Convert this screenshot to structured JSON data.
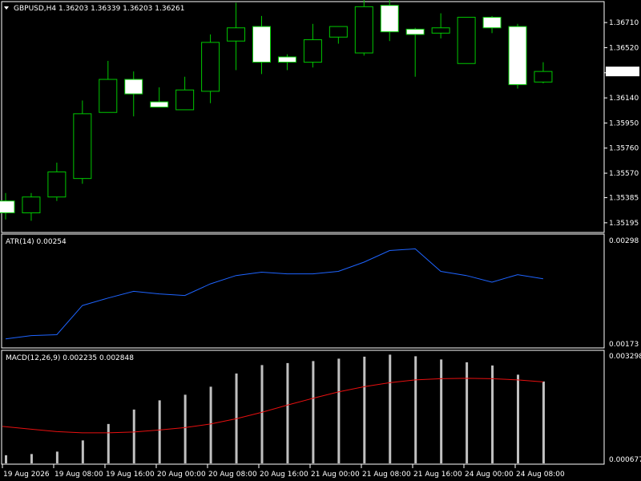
{
  "window": {
    "symbol_line": "GBPUSD,H4  1.36203 1.36339 1.36203 1.36261",
    "current_price_label": "1.36261"
  },
  "colors": {
    "background": "#000000",
    "panel_border": "#ffffff",
    "bull_candle": "#00c800",
    "bear_fill": "#ffffff",
    "atr_line": "#1e64ff",
    "macd_signal": "#e81010",
    "macd_hist": "#c0c0c0"
  },
  "chart_data": [
    {
      "type": "candlestick",
      "title": "GBPUSD,H4",
      "ohlc_text": "1.36203 1.36339 1.36203 1.36261",
      "y_ticks": [
        1.35195,
        1.35385,
        1.3557,
        1.3576,
        1.3595,
        1.3614,
        1.3633,
        1.3652,
        1.3671
      ],
      "y_tick_labels": [
        "1.35195",
        "1.35385",
        "1.35570",
        "1.35760",
        "1.35950",
        "1.36140",
        "1.36330",
        "1.36520",
        "1.36710"
      ],
      "ylim": [
        1.3517,
        1.3682
      ],
      "candles": [
        {
          "o": 1.3536,
          "h": 1.3542,
          "l": 1.3522,
          "c": 1.3527
        },
        {
          "o": 1.3527,
          "h": 1.3542,
          "l": 1.3521,
          "c": 1.3539
        },
        {
          "o": 1.3539,
          "h": 1.3565,
          "l": 1.3536,
          "c": 1.3558
        },
        {
          "o": 1.3553,
          "h": 1.3612,
          "l": 1.3549,
          "c": 1.3602
        },
        {
          "o": 1.3603,
          "h": 1.3642,
          "l": 1.3603,
          "c": 1.3628
        },
        {
          "o": 1.3628,
          "h": 1.3634,
          "l": 1.36,
          "c": 1.3617
        },
        {
          "o": 1.3611,
          "h": 1.3622,
          "l": 1.3608,
          "c": 1.3607
        },
        {
          "o": 1.3605,
          "h": 1.363,
          "l": 1.3605,
          "c": 1.362
        },
        {
          "o": 1.3619,
          "h": 1.3662,
          "l": 1.361,
          "c": 1.3656
        },
        {
          "o": 1.3657,
          "h": 1.3686,
          "l": 1.3635,
          "c": 1.3667
        },
        {
          "o": 1.3668,
          "h": 1.3676,
          "l": 1.3632,
          "c": 1.3641
        },
        {
          "o": 1.3645,
          "h": 1.3647,
          "l": 1.3635,
          "c": 1.3641
        },
        {
          "o": 1.3641,
          "h": 1.367,
          "l": 1.3637,
          "c": 1.3658
        },
        {
          "o": 1.366,
          "h": 1.3667,
          "l": 1.3655,
          "c": 1.3668
        },
        {
          "o": 1.3648,
          "h": 1.369,
          "l": 1.3646,
          "c": 1.3683
        },
        {
          "o": 1.3684,
          "h": 1.3704,
          "l": 1.3657,
          "c": 1.3664
        },
        {
          "o": 1.3666,
          "h": 1.3667,
          "l": 1.363,
          "c": 1.3662
        },
        {
          "o": 1.3663,
          "h": 1.3678,
          "l": 1.3659,
          "c": 1.3667
        },
        {
          "o": 1.364,
          "h": 1.3675,
          "l": 1.364,
          "c": 1.3675
        },
        {
          "o": 1.3675,
          "h": 1.3676,
          "l": 1.3663,
          "c": 1.3667
        },
        {
          "o": 1.3668,
          "h": 1.367,
          "l": 1.3621,
          "c": 1.3624
        },
        {
          "o": 1.3626,
          "h": 1.3641,
          "l": 1.3625,
          "c": 1.3634
        }
      ]
    },
    {
      "type": "line",
      "title": "ATR(14) 0.00254",
      "y_tick_labels": [
        "0.00298",
        "0.00173"
      ],
      "ylim": [
        0.00173,
        0.00298
      ],
      "series": [
        {
          "values": [
            0.0018,
            0.00184,
            0.00185,
            0.0022,
            0.00229,
            0.00237,
            0.00234,
            0.00232,
            0.00246,
            0.00256,
            0.0026,
            0.00258,
            0.00258,
            0.00261,
            0.00272,
            0.00286,
            0.00288,
            0.00261,
            0.00256,
            0.00248,
            0.00257,
            0.00252
          ]
        }
      ]
    },
    {
      "type": "bar",
      "title": "MACD(12,26,9) 0.002235 0.002848",
      "y_tick_labels": [
        "0.003298",
        "0.000677"
      ],
      "ylim": [
        0.000677,
        0.003298
      ],
      "histogram": [
        0.0008,
        0.00083,
        0.00089,
        0.00117,
        0.00158,
        0.00194,
        0.00217,
        0.00231,
        0.00251,
        0.00284,
        0.00305,
        0.0031,
        0.00315,
        0.00321,
        0.00326,
        0.00331,
        0.00327,
        0.00319,
        0.00312,
        0.00304,
        0.00281,
        0.00264
      ],
      "series": [
        {
          "values": [
            0.00152,
            0.00145,
            0.00139,
            0.00136,
            0.00136,
            0.00138,
            0.00143,
            0.00149,
            0.00158,
            0.00171,
            0.00187,
            0.00205,
            0.00222,
            0.00238,
            0.00251,
            0.00261,
            0.00268,
            0.00271,
            0.00272,
            0.00271,
            0.00268,
            0.00263
          ]
        }
      ]
    }
  ],
  "time_axis": {
    "labels": [
      "19 Aug 2026",
      "19 Aug 08:00",
      "19 Aug 16:00",
      "20 Aug 00:00",
      "20 Aug 08:00",
      "20 Aug 16:00",
      "21 Aug 00:00",
      "21 Aug 08:00",
      "21 Aug 16:00",
      "24 Aug 00:00",
      "24 Aug 08:00"
    ]
  }
}
